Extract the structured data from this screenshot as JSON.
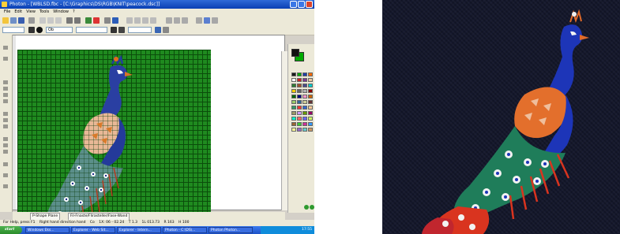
{
  "window": {
    "title": "Photon - [WBLSD.fbc - [C:\\Graphics\\DS\\RGB\\KNIT\\peacock.dsc]]",
    "menu": [
      "File",
      "Edit",
      "View",
      "Tools",
      "Window",
      "?"
    ]
  },
  "toolbar2": {
    "layer_value": "",
    "mode_value": "Ob",
    "size_value": ""
  },
  "tabs": [
    {
      "label": "P-Shape Plane"
    },
    {
      "label": "Fil-Fnaste/Flirasteller/Fase-Wand"
    }
  ],
  "status_bar": {
    "left_text": "For Help, press F1",
    "items": [
      "Right hand direction hand",
      "Co",
      "1X: 06 - 02.24",
      "T 1.3",
      "1L 013.73",
      "R 163",
      "H 100"
    ]
  },
  "taskbar": {
    "start_label": "start",
    "tasks": [
      "Windows Eks...",
      "Explorer - Web Sit...",
      "Explorer - Intern...",
      "Photon - C:\\DS\\...",
      "Photon Photon..."
    ],
    "clock": "17:55"
  },
  "palette": {
    "colors": [
      "#1a1a1a",
      "#00aa00",
      "#1f3fa8",
      "#ff6a00",
      "#ffffff",
      "#cc2222",
      "#7a3b8f",
      "#e8c8a0",
      "#2e7d32",
      "#a0522d",
      "#4a4a8a",
      "#00cccc",
      "#ffcc00",
      "#666666",
      "#b0b0b0",
      "#8b0000",
      "#006400",
      "#000080",
      "#ff99cc",
      "#cc6600",
      "#99cc66",
      "#336699",
      "#cccc99",
      "#663333",
      "#339966",
      "#ff3333",
      "#3366cc",
      "#ffcc99",
      "#999966",
      "#cc99ff",
      "#669900",
      "#990066",
      "#00ffcc",
      "#ff6666",
      "#6666ff",
      "#ccff66",
      "#996633",
      "#33cc33",
      "#cc3399",
      "#3399ff",
      "#ffff99",
      "#9966cc",
      "#66cccc",
      "#cc9966"
    ]
  }
}
